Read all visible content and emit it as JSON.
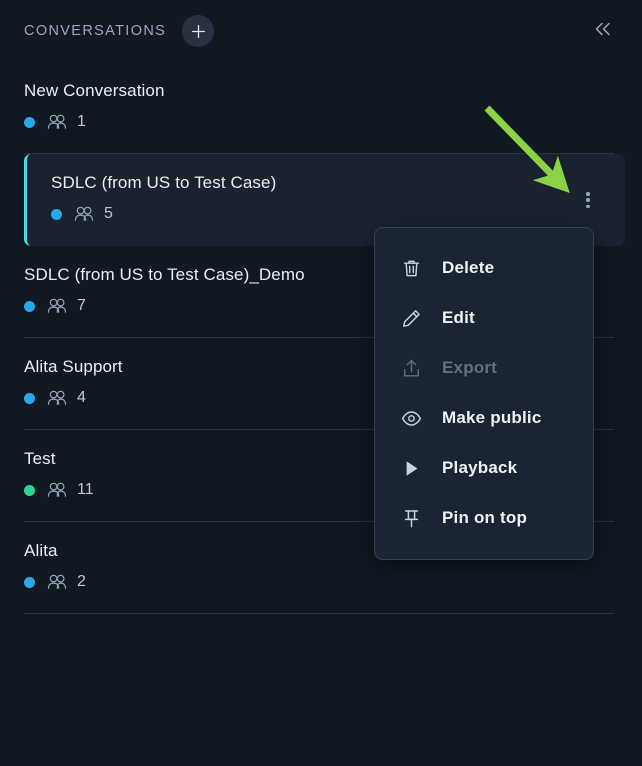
{
  "header": {
    "title": "CONVERSATIONS",
    "add_icon": "plus-icon",
    "collapse_icon": "chevron-double-left-icon"
  },
  "colors": {
    "background": "#101822",
    "card_background": "#1a2230",
    "menu_background": "#1b2432",
    "selected_accent": "#4dd8ec",
    "status_blue": "#29a8e8",
    "status_green": "#2ed396",
    "annotation_arrow": "#8bd345",
    "divider": "#2b3341",
    "text_primary": "#e9eef5",
    "text_muted": "#9aa7ba",
    "text_disabled": "#646e7d"
  },
  "conversations": [
    {
      "title": "New Conversation",
      "status": "blue",
      "participants": "1",
      "selected": false
    },
    {
      "title": "SDLC (from US to Test Case)",
      "status": "blue",
      "participants": "5",
      "selected": true
    },
    {
      "title": "SDLC (from US to Test Case)_Demo",
      "status": "blue",
      "participants": "7",
      "selected": false
    },
    {
      "title": "Alita Support",
      "status": "blue",
      "participants": "4",
      "selected": false
    },
    {
      "title": "Test",
      "status": "green",
      "participants": "11",
      "selected": false
    },
    {
      "title": "Alita",
      "status": "blue",
      "participants": "2",
      "selected": false
    }
  ],
  "context_menu": {
    "items": [
      {
        "label": "Delete",
        "icon": "trash-icon",
        "disabled": false
      },
      {
        "label": "Edit",
        "icon": "pencil-icon",
        "disabled": false
      },
      {
        "label": "Export",
        "icon": "upload-icon",
        "disabled": true
      },
      {
        "label": "Make public",
        "icon": "eye-icon",
        "disabled": false
      },
      {
        "label": "Playback",
        "icon": "play-icon",
        "disabled": false
      },
      {
        "label": "Pin on top",
        "icon": "pin-icon",
        "disabled": false
      }
    ]
  },
  "annotation": {
    "type": "arrow",
    "points_to": "conversation-options-menu-button"
  }
}
